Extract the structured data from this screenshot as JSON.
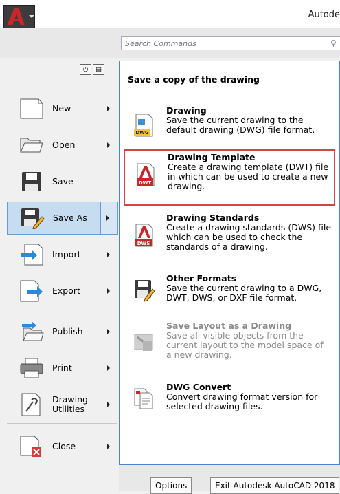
{
  "window": {
    "title": "Autode"
  },
  "search": {
    "placeholder": "Search Commands"
  },
  "menu": {
    "items": [
      {
        "label": "New"
      },
      {
        "label": "Open"
      },
      {
        "label": "Save"
      },
      {
        "label": "Save As",
        "active": true
      },
      {
        "label": "Import"
      },
      {
        "label": "Export"
      },
      {
        "label": "Publish"
      },
      {
        "label": "Print"
      },
      {
        "label": "Drawing\nUtilities"
      },
      {
        "label": "Close"
      }
    ]
  },
  "panel": {
    "header": "Save a copy of the drawing",
    "options": [
      {
        "title": "Drawing",
        "desc": "Save the current drawing to the default drawing (DWG) file format.",
        "icon": "dwg-file-icon",
        "badge": "DWG"
      },
      {
        "title": "Drawing Template",
        "desc": "Create a drawing template (DWT) file in which can be used to create a new drawing.",
        "icon": "dwt-file-icon",
        "badge": "DWT",
        "highlighted": true
      },
      {
        "title": "Drawing Standards",
        "desc": "Create a drawing standards (DWS) file which can be used to check the standards of a drawing.",
        "icon": "dws-file-icon",
        "badge": "DWS"
      },
      {
        "title": "Other Formats",
        "desc": "Save the current drawing to a DWG, DWT, DWS, or DXF file format.",
        "icon": "floppy-pencil-icon"
      },
      {
        "title": "Save Layout as a Drawing",
        "desc": "Save all visible objects from the current layout to the model space of a new drawing.",
        "icon": "save-layout-icon",
        "disabled": true
      },
      {
        "title": "DWG Convert",
        "desc": "Convert drawing format version for selected drawing files.",
        "icon": "dwg-convert-icon"
      }
    ]
  },
  "footer": {
    "options_label": "Options",
    "exit_label": "Exit Autodesk AutoCAD 2018"
  },
  "colors": {
    "accent_blue": "#4b86c9",
    "highlight_red": "#d64545",
    "autocad_red": "#c8262b"
  }
}
